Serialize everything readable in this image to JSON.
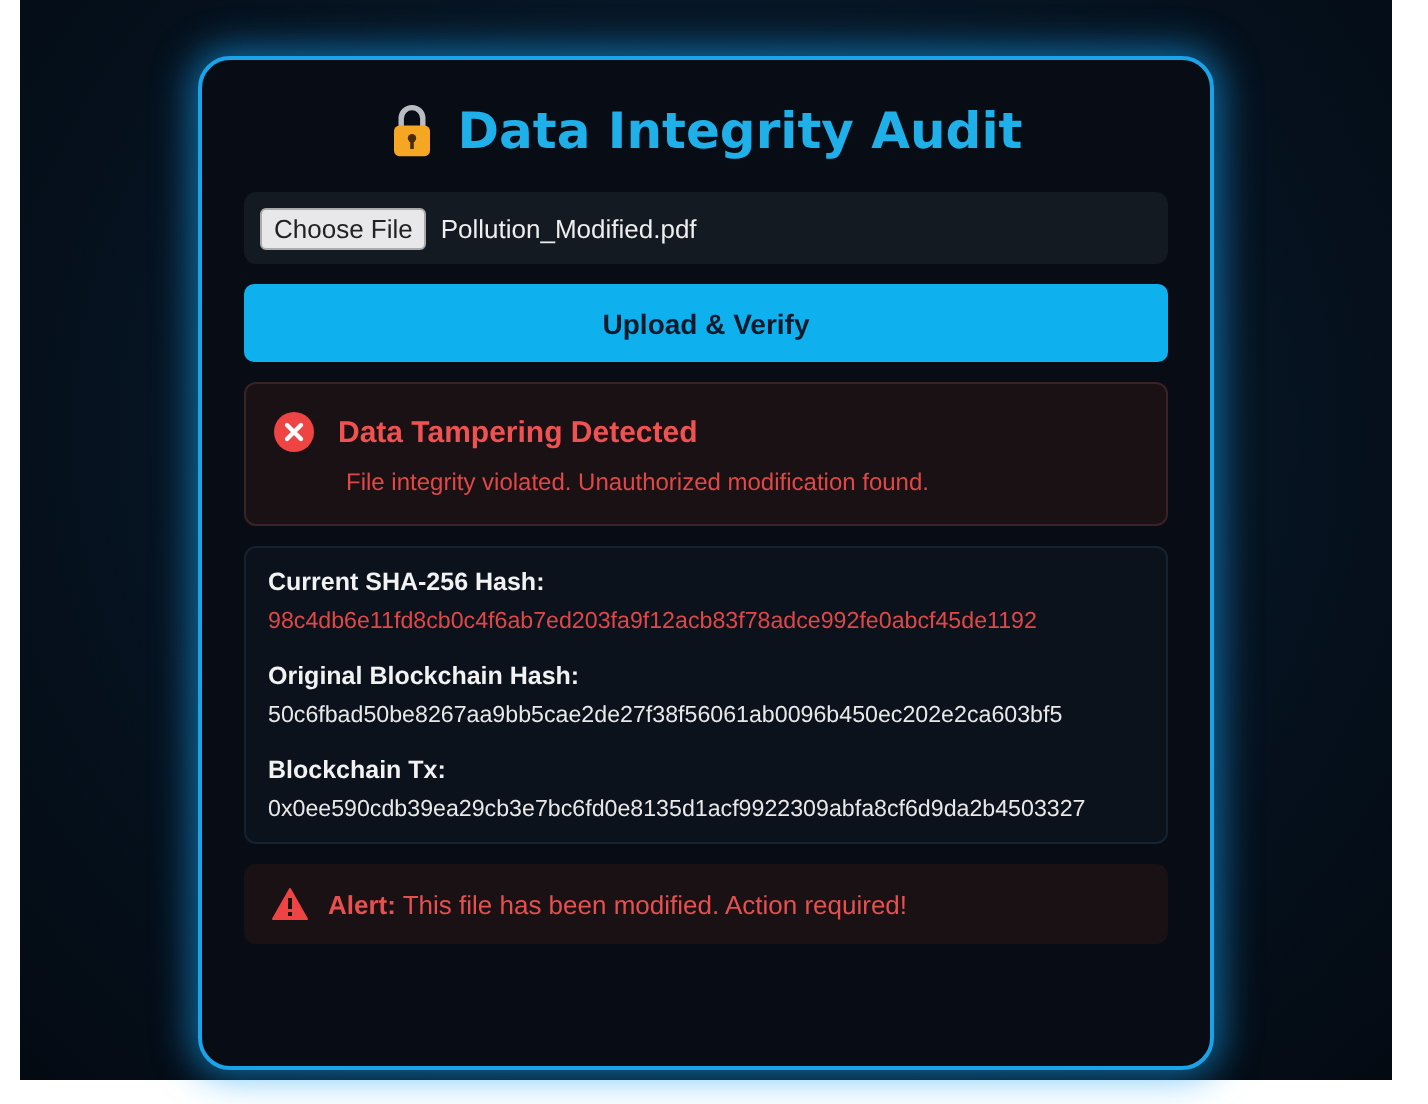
{
  "title": "Data Integrity Audit",
  "file_input": {
    "button": "Choose File",
    "file_name": "Pollution_Modified.pdf"
  },
  "upload_button": "Upload & Verify",
  "error": {
    "title": "Data Tampering Detected",
    "message": "File integrity violated. Unauthorized modification found."
  },
  "details": [
    {
      "label": "Current SHA-256 Hash:",
      "value": "98c4db6e11fd8cb0c4f6ab7ed203fa9f12acb83f78adce992fe0abcf45de1192",
      "kind": "mismatch"
    },
    {
      "label": "Original Blockchain Hash:",
      "value": "50c6fbad50be8267aa9bb5cae2de27f38f56061ab0096b450ec202e2ca603bf5",
      "kind": "normal"
    },
    {
      "label": "Blockchain Tx:",
      "value": "0x0ee590cdb39ea29cb3e7bc6fd0e8135d1acf9922309abfa8cf6d9da2b4503327",
      "kind": "normal"
    }
  ],
  "alert": "**Alert:** This file has been modified. Action required!"
}
